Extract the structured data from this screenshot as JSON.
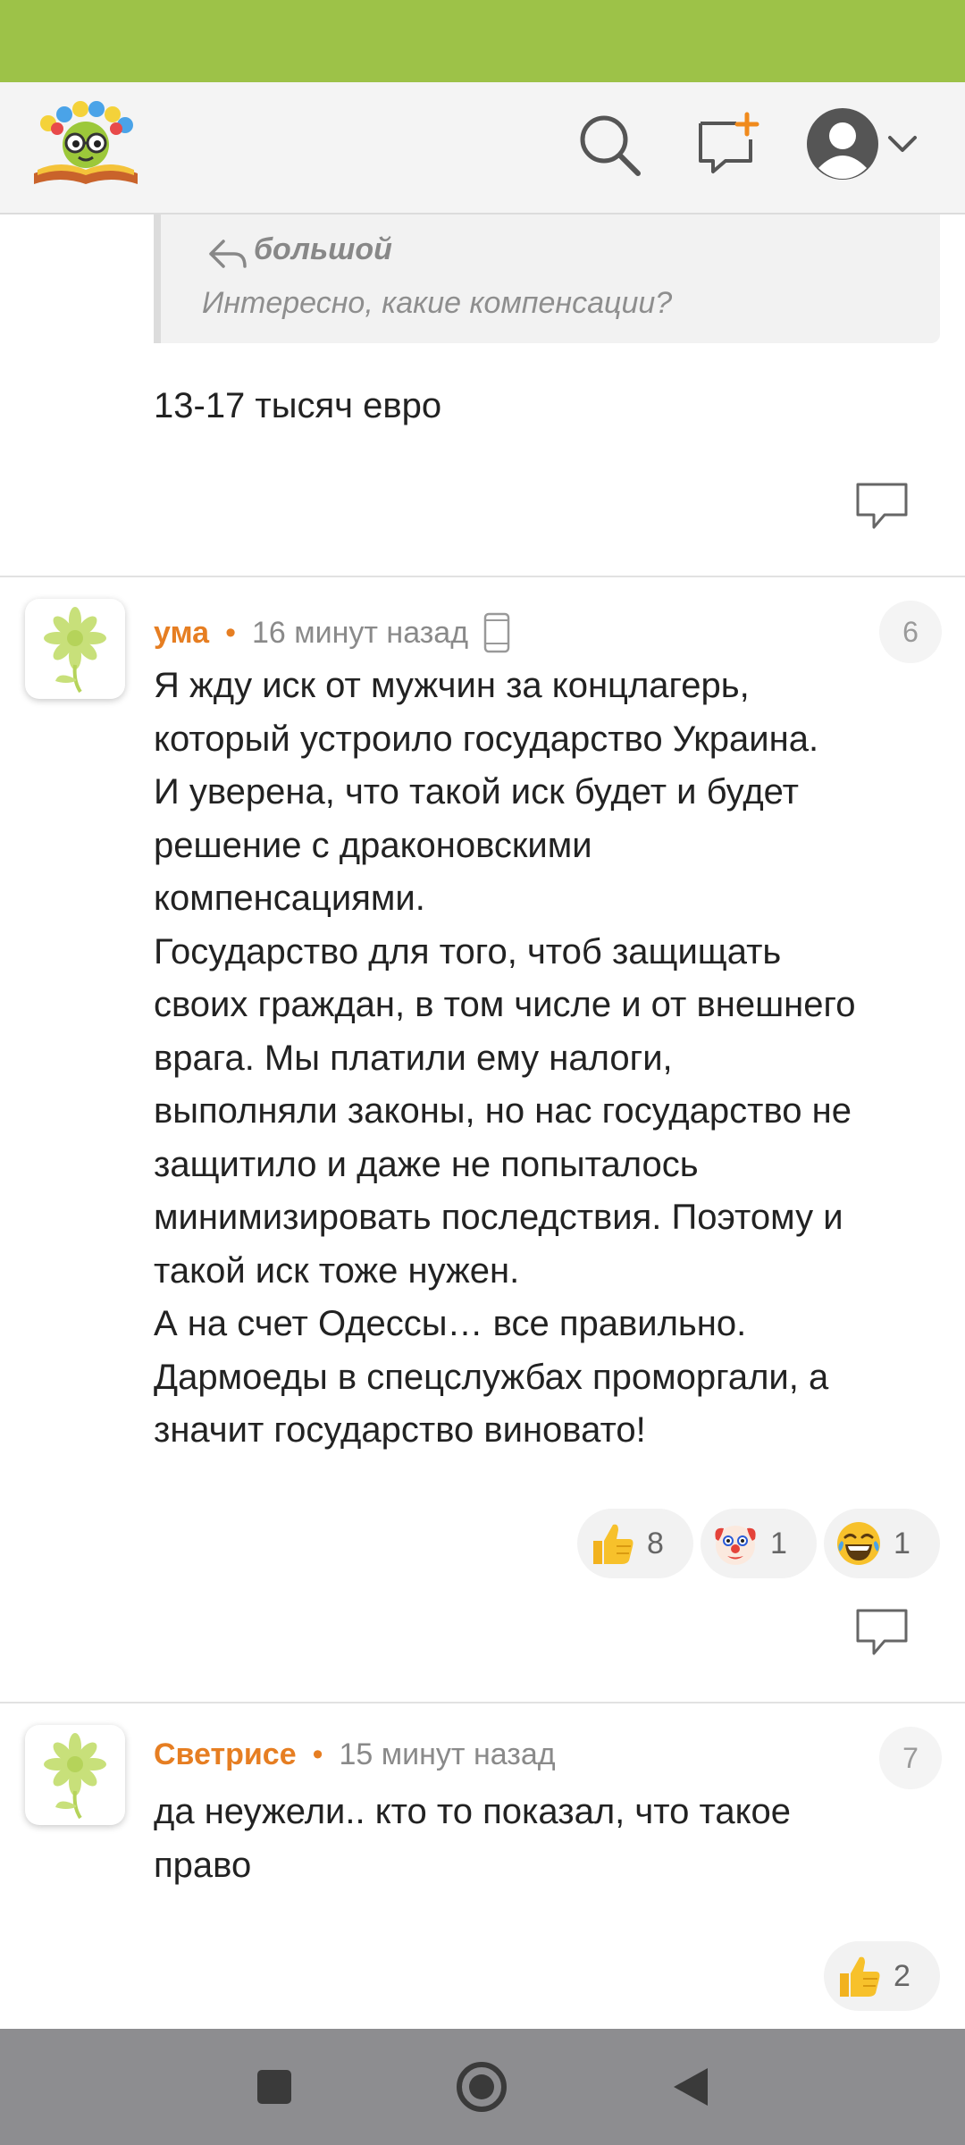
{
  "quote": {
    "author": "большой",
    "text": "Интересно, какие компенсации?"
  },
  "reply": {
    "text": "13-17 тысяч евро"
  },
  "comments": [
    {
      "author": "ума",
      "separator": "•",
      "time": "16 минут назад",
      "number": "6",
      "lines": [
        "Я жду иск от мужчин за концлагерь,",
        "который устроило государство Украина.",
        "И уверена, что такой иск будет и будет",
        "решение с драконовскими",
        "компенсациями.",
        "Государство для того, чтоб защищать",
        "своих граждан, в том числе и от внешнего",
        "врага. Мы платили ему налоги,",
        "выполняли законы, но нас государство не",
        "защитило и даже не попыталось",
        "минимизировать последствия. Поэтому и",
        "такой иск тоже нужен.",
        "А на счет Одессы… все правильно.",
        "Дармоеды в спецслужбах проморгали, а",
        "значит государство виновато!"
      ],
      "reactions": [
        {
          "icon": "thumbs-up-emoji",
          "count": "8"
        },
        {
          "icon": "clown-emoji",
          "count": "1"
        },
        {
          "icon": "laughing-emoji",
          "count": "1"
        }
      ]
    },
    {
      "author": "Светрисе",
      "separator": "•",
      "time": "15 минут назад",
      "number": "7",
      "lines": [
        "да неужели.. кто то показал, что такое",
        "право"
      ],
      "reactions": [
        {
          "icon": "thumbs-up-emoji",
          "count": "2"
        }
      ]
    }
  ],
  "colors": {
    "status_bar": "#9dc248",
    "author": "#e67e22",
    "header_bg": "#f4f4f4",
    "nav_bar": "#8d8d90"
  }
}
